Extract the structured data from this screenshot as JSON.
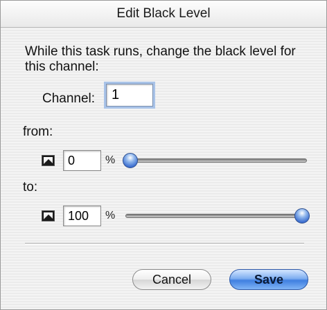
{
  "dialog": {
    "title": "Edit Black Level",
    "prompt": "While this task runs, change the black level for this channel:",
    "channel_label": "Channel:",
    "channel_value": "1"
  },
  "from": {
    "label": "from:",
    "value": "0",
    "unit": "%",
    "slider_percent": 0,
    "icon": "picture-icon"
  },
  "to": {
    "label": "to:",
    "value": "100",
    "unit": "%",
    "slider_percent": 100,
    "icon": "picture-icon"
  },
  "buttons": {
    "cancel": "Cancel",
    "save": "Save"
  },
  "colors": {
    "accent": "#3f7fe0",
    "focus_ring": "#a9c3e8"
  }
}
